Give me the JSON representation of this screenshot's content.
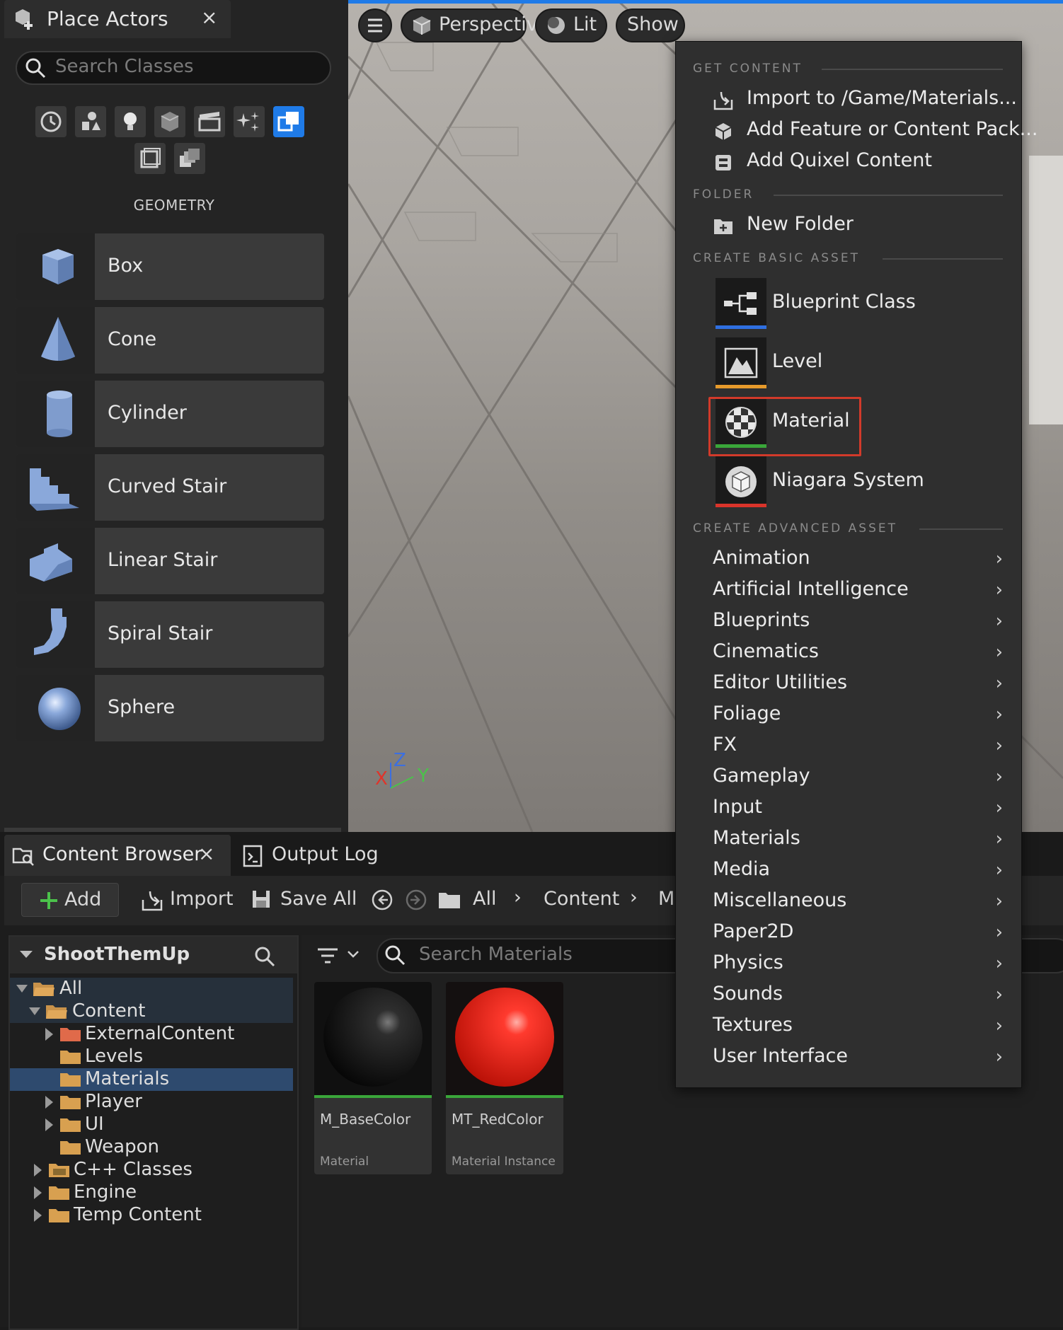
{
  "place_actors": {
    "tab_title": "Place Actors",
    "close": "×",
    "search_placeholder": "Search Classes",
    "section_label": "GEOMETRY",
    "items": [
      {
        "label": "Box"
      },
      {
        "label": "Cone"
      },
      {
        "label": "Cylinder"
      },
      {
        "label": "Curved Stair"
      },
      {
        "label": "Linear Stair"
      },
      {
        "label": "Spiral Stair"
      },
      {
        "label": "Sphere"
      }
    ]
  },
  "viewport": {
    "perspective_label": "Perspective",
    "lit_label": "Lit",
    "show_label": "Show",
    "axis": {
      "x": "X",
      "y": "Y",
      "z": "Z"
    }
  },
  "menu": {
    "sections": {
      "get_content": "GET CONTENT",
      "folder": "FOLDER",
      "create_basic": "CREATE BASIC ASSET",
      "create_advanced": "CREATE ADVANCED ASSET"
    },
    "get_content_items": [
      {
        "label": "Import to /Game/Materials..."
      },
      {
        "label": "Add Feature or Content Pack..."
      },
      {
        "label": "Add Quixel Content"
      }
    ],
    "folder_items": [
      {
        "label": "New Folder"
      }
    ],
    "basic_assets": [
      {
        "label": "Blueprint Class",
        "color": "#2f6fe0"
      },
      {
        "label": "Level",
        "color": "#e69a2b"
      },
      {
        "label": "Material",
        "color": "#3aa63a"
      },
      {
        "label": "Niagara System",
        "color": "#d9342a"
      }
    ],
    "advanced_assets": [
      {
        "label": "Animation"
      },
      {
        "label": "Artificial Intelligence"
      },
      {
        "label": "Blueprints"
      },
      {
        "label": "Cinematics"
      },
      {
        "label": "Editor Utilities"
      },
      {
        "label": "Foliage"
      },
      {
        "label": "FX"
      },
      {
        "label": "Gameplay"
      },
      {
        "label": "Input"
      },
      {
        "label": "Materials"
      },
      {
        "label": "Media"
      },
      {
        "label": "Miscellaneous"
      },
      {
        "label": "Paper2D"
      },
      {
        "label": "Physics"
      },
      {
        "label": "Sounds"
      },
      {
        "label": "Textures"
      },
      {
        "label": "User Interface"
      }
    ]
  },
  "content_browser": {
    "tab_title": "Content Browser",
    "close": "×",
    "output_log_label": "Output Log",
    "add_label": "Add",
    "import_label": "Import",
    "save_all_label": "Save All",
    "breadcrumb": {
      "all": "All",
      "content": "Content",
      "truncated": "M"
    },
    "project_name": "ShootThemUp",
    "search_placeholder": "Search Materials",
    "tree": [
      {
        "label": "All"
      },
      {
        "label": "Content"
      },
      {
        "label": "ExternalContent"
      },
      {
        "label": "Levels"
      },
      {
        "label": "Materials"
      },
      {
        "label": "Player"
      },
      {
        "label": "UI"
      },
      {
        "label": "Weapon"
      },
      {
        "label": "C++ Classes"
      },
      {
        "label": "Engine"
      },
      {
        "label": "Temp Content"
      }
    ],
    "assets": [
      {
        "name": "M_BaseColor",
        "type": "Material",
        "bar_color": "#3aa63a"
      },
      {
        "name": "MT_RedColor",
        "type": "Material Instance",
        "bar_color": "#3aa63a"
      }
    ]
  }
}
